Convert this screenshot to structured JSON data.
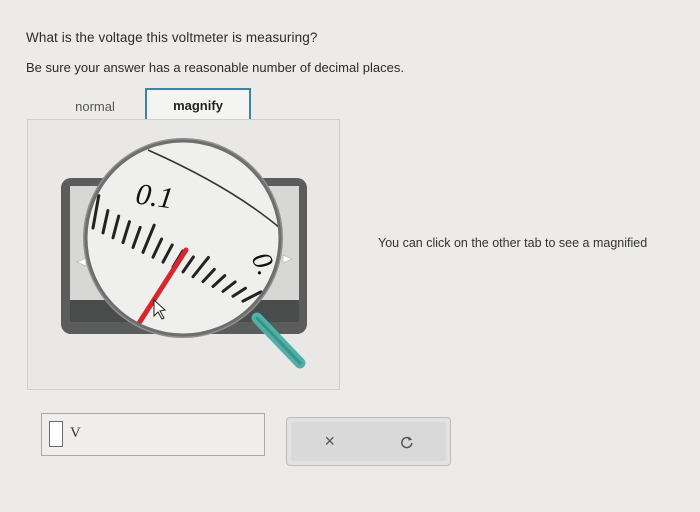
{
  "question": {
    "text": "What is the voltage this voltmeter is measuring?",
    "instructions": "Be sure your answer has a reasonable number of decimal places."
  },
  "tabs": [
    {
      "label": "normal",
      "active": false
    },
    {
      "label": "magnify",
      "active": true
    }
  ],
  "meter": {
    "scale_label_top": "0.1",
    "scale_label_right": "0.",
    "body_color": "#5b5d5c",
    "face_color": "#d7d7d5",
    "needle_color": "#d8262e",
    "handle_color": "#4fb1a6"
  },
  "hint_text": "You can click on the other tab to see a magnified",
  "answer": {
    "value": "",
    "unit": "V"
  },
  "actions": {
    "clear_symbol": "×",
    "reset_icon": "undo-icon"
  }
}
